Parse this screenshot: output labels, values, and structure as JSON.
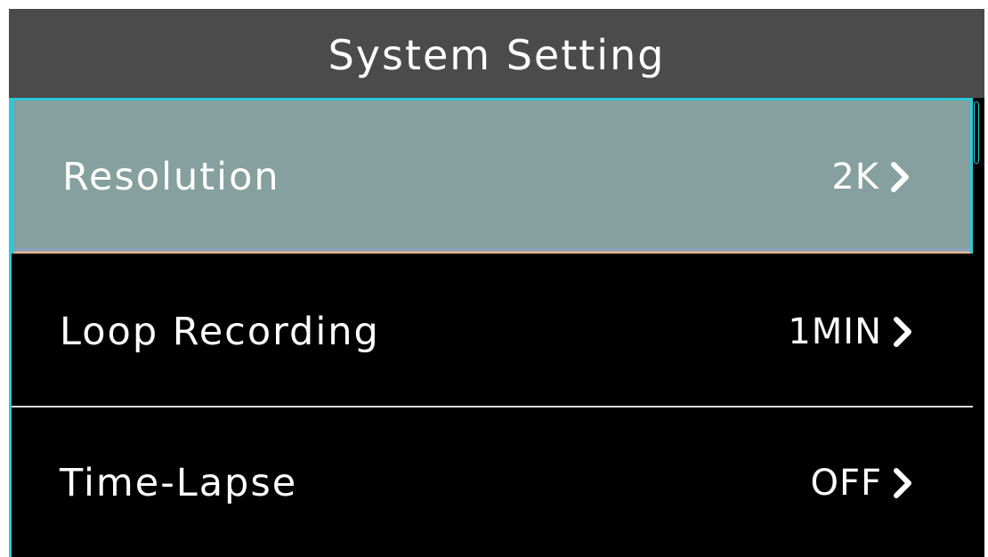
{
  "title": "System Setting",
  "items": [
    {
      "label": "Resolution",
      "value": "2K",
      "selected": true
    },
    {
      "label": "Loop Recording",
      "value": "1MIN",
      "selected": false
    },
    {
      "label": "Time-Lapse",
      "value": "OFF",
      "selected": false
    }
  ],
  "colors": {
    "title_bar": "#4b4b4b",
    "background": "#000000",
    "selected_row": "#85a09e",
    "accent": "#2fc8d6",
    "text": "#ffffff"
  },
  "icons": {
    "chevron": "chevron-right-icon"
  }
}
